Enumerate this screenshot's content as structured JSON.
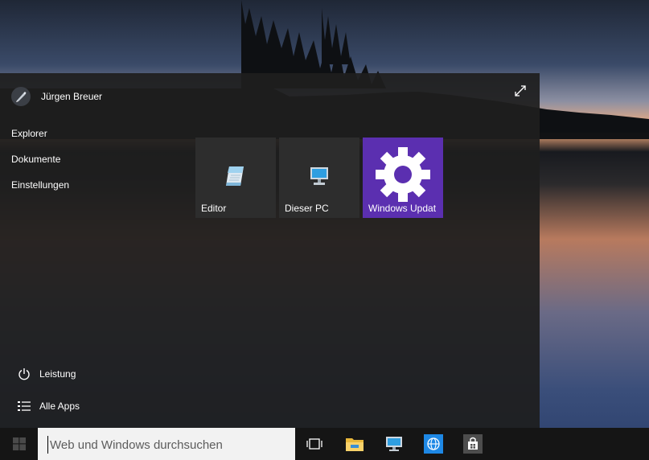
{
  "user": {
    "name": "Jürgen Breuer"
  },
  "places": [
    {
      "label": "Explorer"
    },
    {
      "label": "Dokumente"
    },
    {
      "label": "Einstellungen"
    }
  ],
  "power": {
    "label": "Leistung"
  },
  "all_apps": {
    "label": "Alle Apps"
  },
  "tiles": [
    {
      "label": "Editor",
      "color": "#2d2d2d"
    },
    {
      "label": "Dieser PC",
      "color": "#2d2d2d"
    },
    {
      "label": "Windows Updat",
      "color": "#5b2fb0"
    }
  ],
  "search": {
    "placeholder": "Web und Windows durchsuchen"
  },
  "taskbar_icons": [
    "task-view-icon",
    "file-explorer-icon",
    "this-pc-icon",
    "internet-explorer-icon",
    "store-icon"
  ]
}
